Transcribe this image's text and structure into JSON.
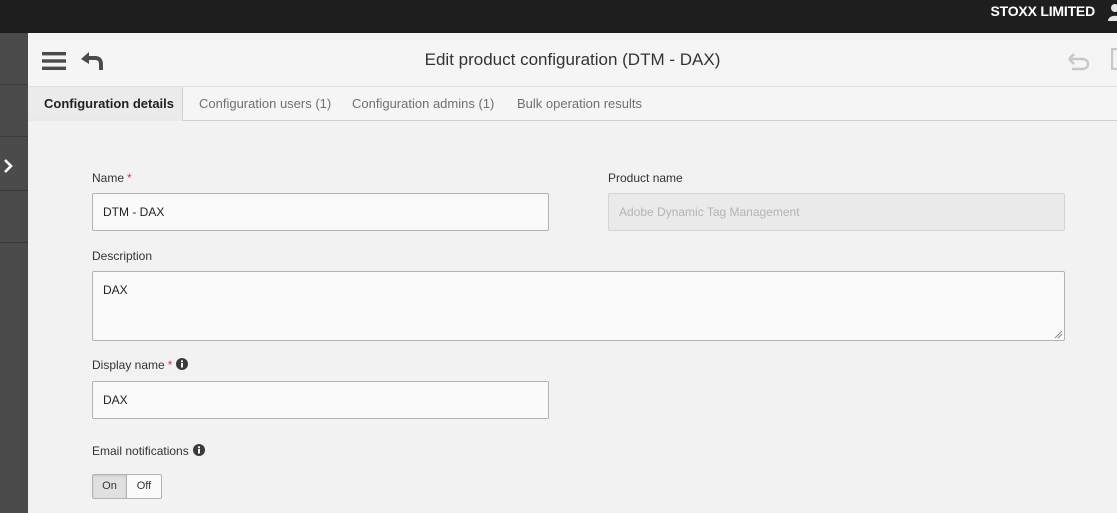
{
  "topbar": {
    "org_name": "STOXX LIMITED"
  },
  "header": {
    "title": "Edit product configuration (DTM - DAX)"
  },
  "tabs": [
    {
      "label": "Configuration details",
      "active": true
    },
    {
      "label": "Configuration users (1)",
      "active": false
    },
    {
      "label": "Configuration admins (1)",
      "active": false
    },
    {
      "label": "Bulk operation results",
      "active": false
    }
  ],
  "form": {
    "name": {
      "label": "Name",
      "required_mark": "*",
      "value": "DTM - DAX"
    },
    "product_name": {
      "label": "Product name",
      "value": "Adobe Dynamic Tag Management"
    },
    "description": {
      "label": "Description",
      "value": "DAX"
    },
    "display_name": {
      "label": "Display name",
      "required_mark": "*",
      "value": "DAX"
    },
    "email_notifications": {
      "label": "Email notifications",
      "on_label": "On",
      "off_label": "Off",
      "selected": "On"
    }
  },
  "icons": {
    "menu": "hamburger-menu-icon",
    "back": "back-arrow-icon",
    "undo": "undo-icon",
    "save": "save-icon",
    "user": "user-icon",
    "expand": "chevron-right-icon",
    "info": "info-icon"
  },
  "colors": {
    "topbar": "#1e1e1e",
    "rail": "#4b4b4b",
    "required": "#d7373f",
    "content_bg": "#f2f2f2"
  }
}
